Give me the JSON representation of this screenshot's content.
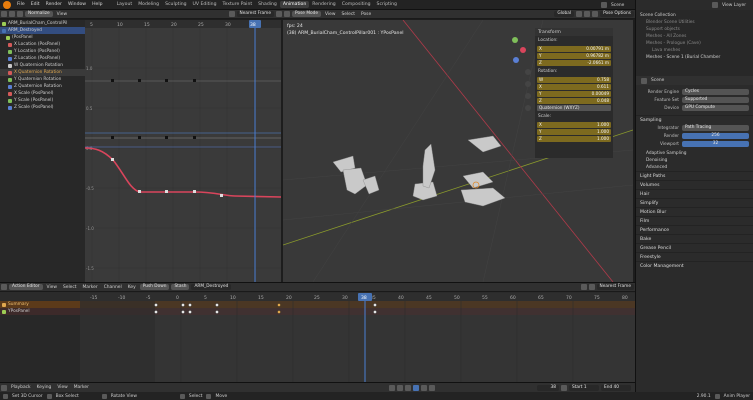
{
  "topbar": {
    "menu": [
      "File",
      "Edit",
      "Render",
      "Window",
      "Help"
    ],
    "tabs": [
      "Layout",
      "Modeling",
      "Sculpting",
      "UV Editing",
      "Texture Paint",
      "Shading",
      "Animation",
      "Rendering",
      "Compositing",
      "Scripting"
    ],
    "active_tab": "Animation",
    "scene": "Scene",
    "view_layer": "View Layer"
  },
  "graph_header": {
    "mode": "Normalize",
    "frame_mode": "Nearest Frame"
  },
  "channels": [
    {
      "label": "ARM_BurialCham_ControlPil",
      "color": "#9ccd55"
    },
    {
      "label": "ARM_Destroyed",
      "color": "#4772b3"
    },
    {
      "label": "(PosPanel",
      "color": "#9ccd55"
    },
    {
      "label": "X Location (PosPanel)",
      "color": "#d45a5a"
    },
    {
      "label": "Y Location (PosPanel)",
      "color": "#7fbf5a"
    },
    {
      "label": "Z Location (PosPanel)",
      "color": "#5a7fd4"
    },
    {
      "label": "W Quaternion Rotation",
      "color": "#c8c8c8"
    },
    {
      "label": "X Quaternion Rotation",
      "color": "#d45a5a"
    },
    {
      "label": "Y Quaternion Rotation",
      "color": "#7fbf5a"
    },
    {
      "label": "Z Quaternion Rotation",
      "color": "#5a7fd4"
    },
    {
      "label": "X Scale (PosPanel)",
      "color": "#d45a5a"
    },
    {
      "label": "Y Scale (PosPanel)",
      "color": "#7fbf5a"
    },
    {
      "label": "Z Scale (PosPanel)",
      "color": "#5a7fd4"
    }
  ],
  "graph_ruler": [
    "5",
    "10",
    "15",
    "20",
    "25",
    "30",
    "35"
  ],
  "graph_yaxis": [
    "1.0",
    "0.5",
    "0.0",
    "-0.5",
    "-1.0",
    "-1.5",
    "-2.0"
  ],
  "viewport_header": {
    "mode": "Pose Mode",
    "view": "View",
    "select": "Select",
    "pose": "Pose",
    "orientation": "Global",
    "options": "Pose Options"
  },
  "viewport_info": {
    "fps": "fps: 24",
    "object": "(38) ARM_BurialCham_ControlPillar001 : YPosPanel"
  },
  "npanel": {
    "title": "Transform",
    "location_label": "Location:",
    "location": [
      {
        "axis": "X",
        "value": "0.00791 m"
      },
      {
        "axis": "Y",
        "value": "0.96782 m"
      },
      {
        "axis": "Z",
        "value": "-2.0661 m"
      }
    ],
    "rotation_label": "Rotation:",
    "rotation": [
      {
        "axis": "W",
        "value": "0.758"
      },
      {
        "axis": "X",
        "value": "0.611"
      },
      {
        "axis": "Y",
        "value": "0.00049"
      },
      {
        "axis": "Z",
        "value": "0.048"
      }
    ],
    "rotation_mode": "Quaternion (WXYZ)",
    "scale_label": "Scale:",
    "scale": [
      {
        "axis": "X",
        "value": "1.000"
      },
      {
        "axis": "Y",
        "value": "1.000"
      },
      {
        "axis": "Z",
        "value": "1.000"
      }
    ]
  },
  "outliner": [
    "Scene Collection",
    "Blender Scene Utilities",
    "Support objects",
    "Meshes - All Zones",
    "Meshes - Prologue (Cave)",
    "Lava meshes",
    "Meshes - Scene 1 (Burial Chamber"
  ],
  "props": {
    "scene_name": "Scene",
    "render_engine_label": "Render Engine",
    "render_engine": "Cycles",
    "feature_set_label": "Feature Set",
    "feature_set": "Supported",
    "device_label": "Device",
    "device": "GPU Compute",
    "sampling": "Sampling",
    "integrator_label": "Integrator",
    "integrator": "Path Tracing",
    "render_label": "Render",
    "render_val": "256",
    "viewport_label": "Viewport",
    "viewport_val": "32",
    "sub_sections": [
      "Adaptive Sampling",
      "Denoising",
      "Advanced"
    ],
    "sections": [
      "Light Paths",
      "Volumes",
      "Hair",
      "Simplify",
      "Motion Blur",
      "Film",
      "Performance",
      "Bake",
      "Grease Pencil",
      "Freestyle",
      "Color Management"
    ]
  },
  "dopesheet_header": {
    "mode": "Action Editor",
    "view": "View",
    "select": "Select",
    "marker": "Marker",
    "channel": "Channel",
    "key": "Key",
    "push_down": "Push Down",
    "stash": "Stash",
    "action": "ARM_Destroyed",
    "frame_mode": "Nearest Frame"
  },
  "dope_ruler": [
    "-15",
    "-10",
    "-5",
    "0",
    "5",
    "10",
    "15",
    "20",
    "25",
    "30",
    "35",
    "40",
    "45",
    "50",
    "55",
    "60",
    "65",
    "70",
    "75",
    "80"
  ],
  "dope_channels": [
    {
      "label": "Summary"
    },
    {
      "label": "YPosPanel"
    }
  ],
  "current_frame": "38",
  "timeline": {
    "playback": "Playback",
    "keying": "Keying",
    "view": "View",
    "marker": "Marker",
    "frame": "38",
    "start_label": "Start",
    "start": "1",
    "end_label": "End",
    "end": "40"
  },
  "status": {
    "cursor": "Set 3D Cursor",
    "box": "Box Select",
    "rotate": "Rotate View",
    "select": "Select",
    "move": "Move",
    "version": "2.90.1",
    "anim": "Anim Player"
  }
}
